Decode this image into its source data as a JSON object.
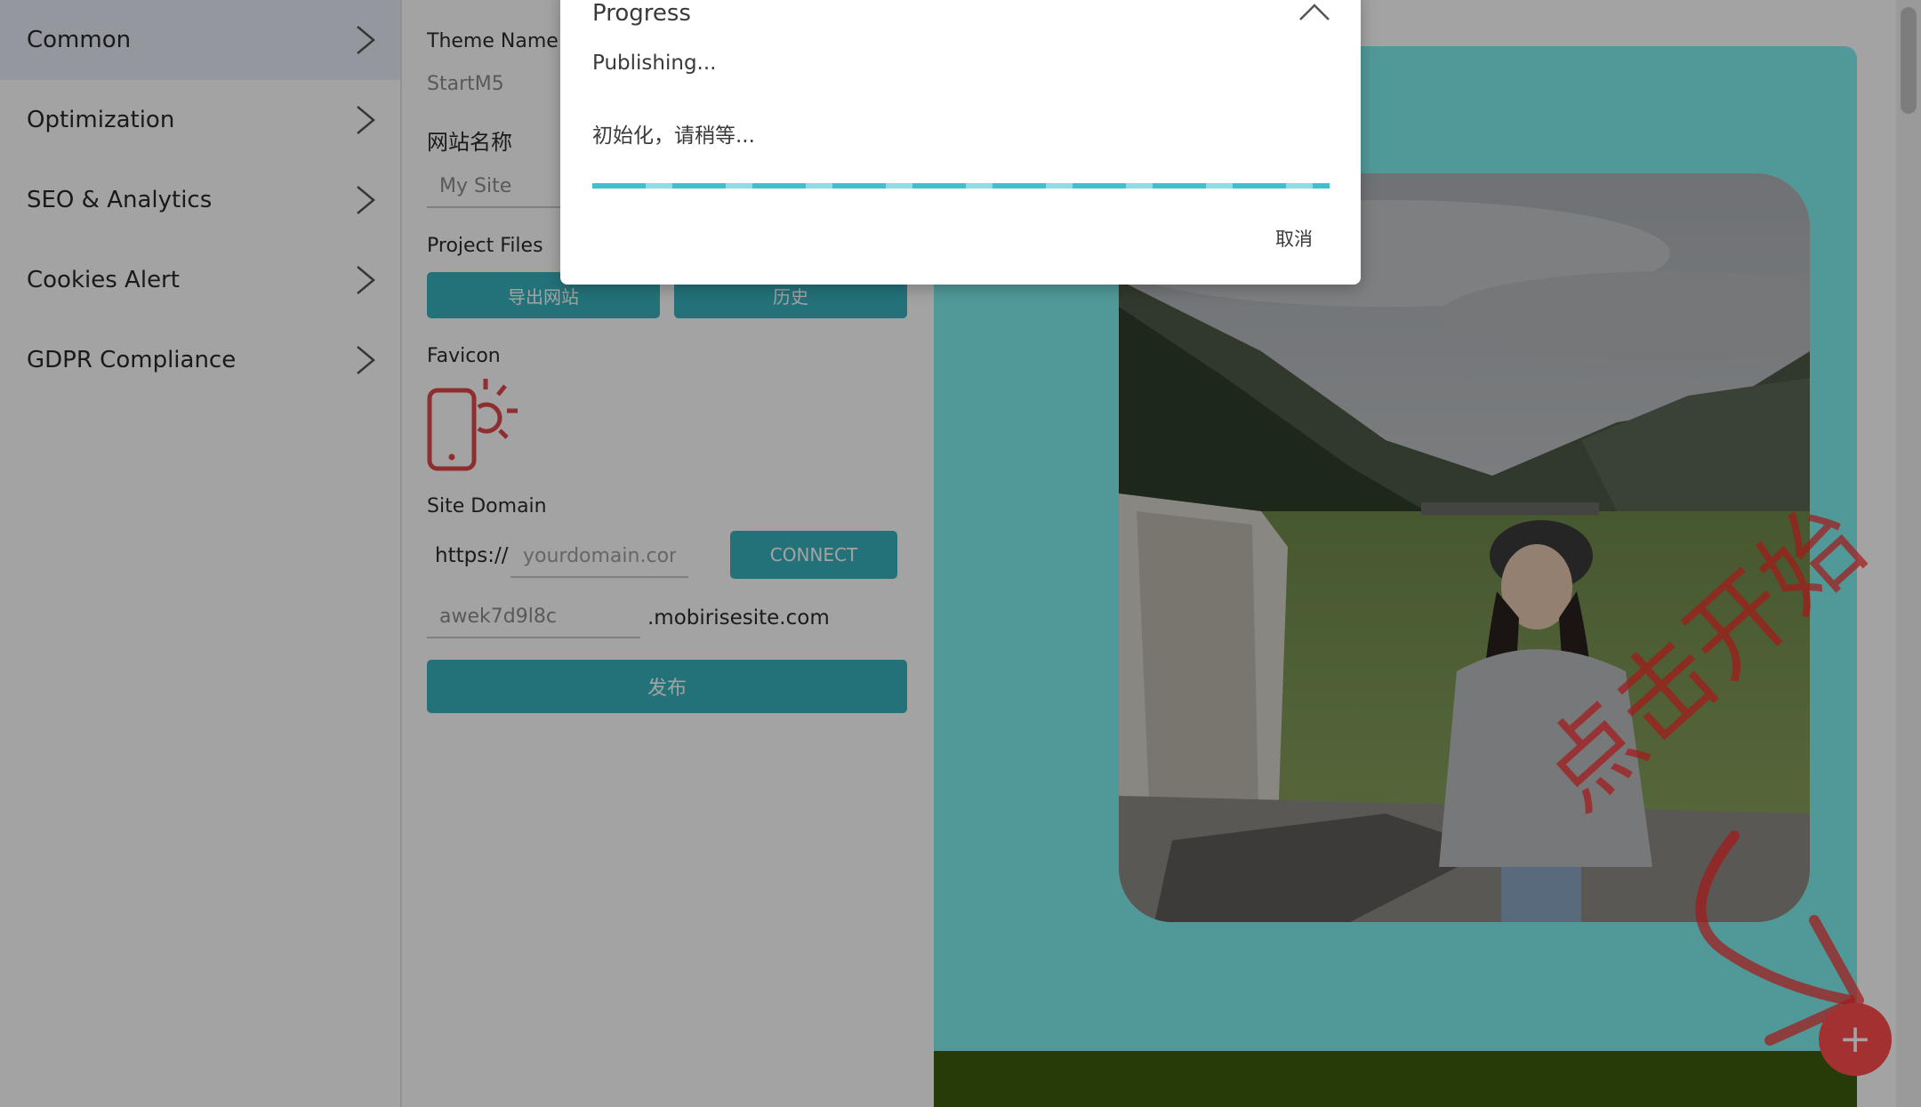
{
  "sidebar": {
    "items": [
      {
        "label": "Common",
        "active": true
      },
      {
        "label": "Optimization"
      },
      {
        "label": "SEO & Analytics"
      },
      {
        "label": "Cookies Alert"
      },
      {
        "label": "GDPR Compliance"
      }
    ]
  },
  "panel": {
    "theme_name_label": "Theme Name",
    "theme_name_value": "StartM5",
    "site_name_label": "网站名称",
    "site_name_value": "My Site",
    "project_files_label": "Project Files",
    "export_button": "导出网站",
    "history_button": "历史",
    "favicon_label": "Favicon",
    "site_domain_label": "Site Domain",
    "https_prefix": "https://",
    "domain_placeholder": "yourdomain.com",
    "connect_button": "CONNECT",
    "subdomain_value": "awek7d9l8c",
    "subdomain_suffix": ".mobirisesite.com",
    "publish_button": "发布"
  },
  "preview": {
    "annotation_text": "点击开始",
    "fab_symbol": "+"
  },
  "dialog": {
    "title": "Progress",
    "message": "Publishing...",
    "status": "初始化，请稍等...",
    "progress_fraction": 1.0,
    "cancel_label": "取消"
  },
  "colors": {
    "accent": "#37b3bd",
    "favicon": "#e04848",
    "preview_teal": "#7ff0ef",
    "fab": "#ff4d4d",
    "annotation": "#ff2828"
  }
}
